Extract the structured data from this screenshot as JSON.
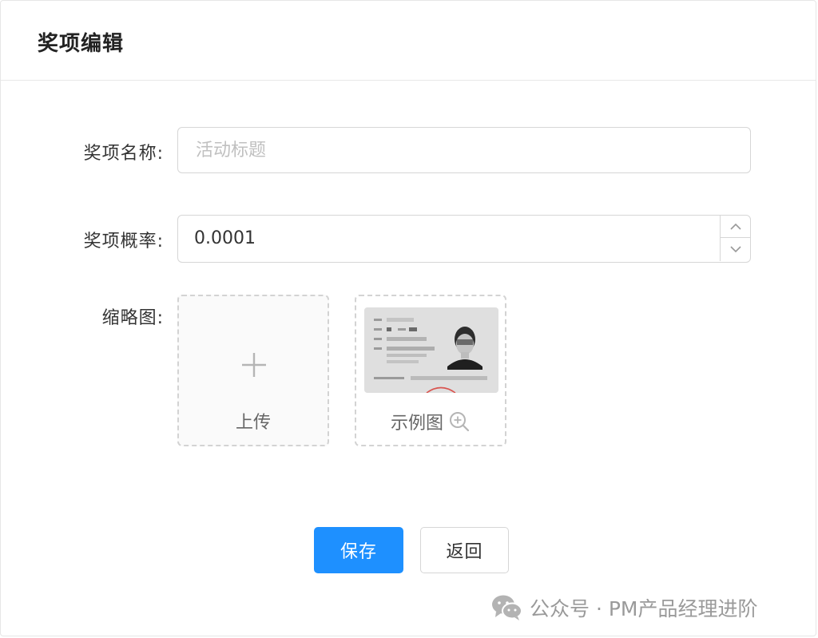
{
  "header": {
    "title": "奖项编辑"
  },
  "form": {
    "name_label": "奖项名称:",
    "name_placeholder": "活动标题",
    "name_value": "",
    "prob_label": "奖项概率:",
    "prob_value": "0.0001",
    "thumb_label": "缩略图:"
  },
  "upload": {
    "label": "上传"
  },
  "example": {
    "label": "示例图"
  },
  "actions": {
    "save_label": "保存",
    "back_label": "返回"
  },
  "watermark": {
    "text": "公众号 · PM产品经理进阶"
  },
  "colors": {
    "primary": "#1e90ff",
    "border": "#d6d6d6",
    "placeholder": "#c0c0c0",
    "watermark": "#9a9a9a"
  },
  "icons": [
    "plus-icon",
    "chevron-up-icon",
    "chevron-down-icon",
    "zoom-in-icon",
    "wechat-icon"
  ]
}
